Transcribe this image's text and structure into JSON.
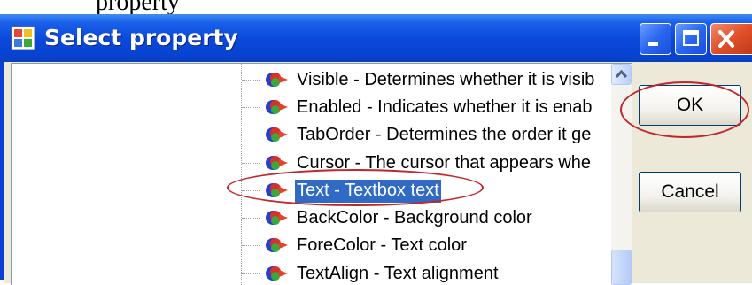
{
  "page": {
    "caption_fragment": "property"
  },
  "window": {
    "title": "Select property",
    "icon": "window-app-icon",
    "controls": [
      "minimize-icon",
      "maximize-icon",
      "close-icon"
    ]
  },
  "property_list": {
    "items": [
      {
        "label": "Visible - Determines whether it is visib",
        "icon": "property-icon",
        "selected": false
      },
      {
        "label": "Enabled - Indicates whether it is enab",
        "icon": "property-icon",
        "selected": false
      },
      {
        "label": "TabOrder - Determines the order it ge",
        "icon": "property-icon",
        "selected": false
      },
      {
        "label": "Cursor - The cursor that appears whe",
        "icon": "property-icon",
        "selected": false
      },
      {
        "label": "Text - Textbox text",
        "icon": "property-icon",
        "selected": true
      },
      {
        "label": "BackColor - Background color",
        "icon": "property-icon",
        "selected": false
      },
      {
        "label": "ForeColor - Text color",
        "icon": "property-icon",
        "selected": false
      },
      {
        "label": "TextAlign - Text alignment",
        "icon": "property-icon",
        "selected": false
      }
    ]
  },
  "buttons": {
    "ok_label": "OK",
    "cancel_label": "Cancel"
  },
  "colors": {
    "titlebar": "#0a48db",
    "selection": "#316ac5",
    "annotation": "#c0272d",
    "dialog_face": "#ece9d8"
  }
}
